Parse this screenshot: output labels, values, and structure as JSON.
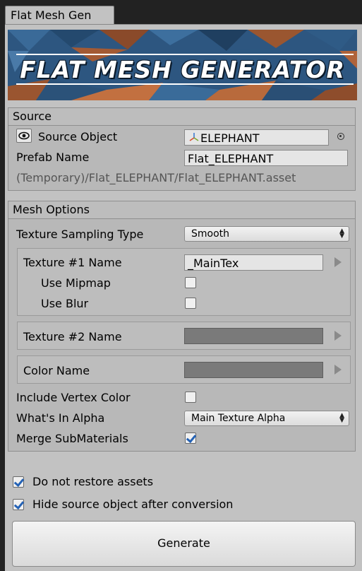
{
  "window": {
    "tab_label": "Flat Mesh Gen"
  },
  "banner": {
    "title": "FLAT MESH GENERATOR"
  },
  "source": {
    "header": "Source",
    "source_object_label": "Source Object",
    "source_object_value": "ELEPHANT",
    "prefab_name_label": "Prefab Name",
    "prefab_name_value": "Flat_ELEPHANT",
    "path": "(Temporary)/Flat_ELEPHANT/Flat_ELEPHANT.asset"
  },
  "mesh_options": {
    "header": "Mesh Options",
    "texture_sampling_label": "Texture Sampling Type",
    "texture_sampling_value": "Smooth",
    "texture1": {
      "label": "Texture #1 Name",
      "value": "_MainTex",
      "use_mipmap_label": "Use Mipmap",
      "use_mipmap": false,
      "use_blur_label": "Use Blur",
      "use_blur": false
    },
    "texture2": {
      "label": "Texture #2 Name",
      "value": ""
    },
    "color": {
      "label": "Color Name",
      "value": ""
    },
    "include_vertex_color_label": "Include Vertex Color",
    "include_vertex_color": false,
    "whats_in_alpha_label": "What's In Alpha",
    "whats_in_alpha_value": "Main Texture Alpha",
    "merge_submaterials_label": "Merge SubMaterials",
    "merge_submaterials": true
  },
  "options": {
    "do_not_restore_label": "Do not restore assets",
    "do_not_restore": true,
    "hide_source_label": "Hide source object after conversion",
    "hide_source": true
  },
  "actions": {
    "generate_label": "Generate"
  },
  "colors": {
    "accent_check": "#2462b5",
    "panel_bg": "#c2c2c2",
    "window_bg": "#222222"
  }
}
